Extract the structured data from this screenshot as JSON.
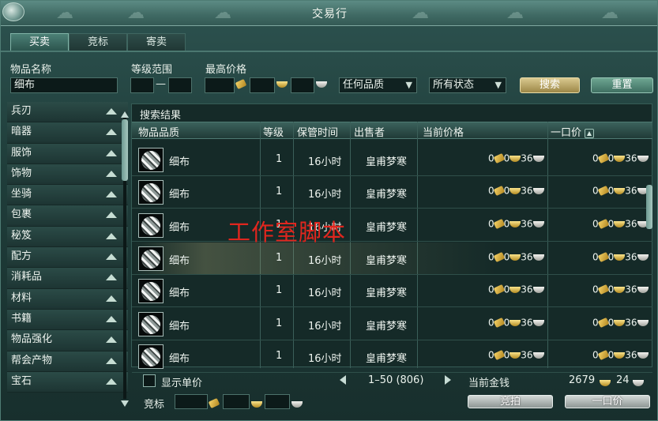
{
  "window": {
    "title": "交易行"
  },
  "tabs": [
    "买卖",
    "竞标",
    "寄卖"
  ],
  "search": {
    "name_label": "物品名称",
    "name_value": "细布",
    "level_label": "等级范围",
    "level_dash": "—",
    "price_label": "最高价格",
    "quality_select": "任何品质",
    "status_select": "所有状态",
    "search_button": "搜索",
    "reset_button": "重置"
  },
  "categories": [
    "兵刃",
    "暗器",
    "服饰",
    "饰物",
    "坐骑",
    "包裹",
    "秘笈",
    "配方",
    "消耗品",
    "材料",
    "书籍",
    "物品强化",
    "帮会产物",
    "宝石"
  ],
  "results": {
    "title": "搜索结果",
    "columns": {
      "quality": "物品品质",
      "level": "等级",
      "duration": "保管时间",
      "seller": "出售者",
      "current_price": "当前价格",
      "buyout": "一口价"
    },
    "rows": [
      {
        "name": "细布",
        "level": "1",
        "duration": "16小时",
        "seller": "皇甫梦寒",
        "cur_gold": "0",
        "cur_silver": "0",
        "cur_copper": "36",
        "buy_gold": "0",
        "buy_silver": "0",
        "buy_copper": "36"
      },
      {
        "name": "细布",
        "level": "1",
        "duration": "16小时",
        "seller": "皇甫梦寒",
        "cur_gold": "0",
        "cur_silver": "0",
        "cur_copper": "36",
        "buy_gold": "0",
        "buy_silver": "0",
        "buy_copper": "36"
      },
      {
        "name": "细布",
        "level": "1",
        "duration": "16小时",
        "seller": "皇甫梦寒",
        "cur_gold": "0",
        "cur_silver": "0",
        "cur_copper": "36",
        "buy_gold": "0",
        "buy_silver": "0",
        "buy_copper": "36"
      },
      {
        "name": "细布",
        "level": "1",
        "duration": "16小时",
        "seller": "皇甫梦寒",
        "cur_gold": "0",
        "cur_silver": "0",
        "cur_copper": "36",
        "buy_gold": "0",
        "buy_silver": "0",
        "buy_copper": "36"
      },
      {
        "name": "细布",
        "level": "1",
        "duration": "16小时",
        "seller": "皇甫梦寒",
        "cur_gold": "0",
        "cur_silver": "0",
        "cur_copper": "36",
        "buy_gold": "0",
        "buy_silver": "0",
        "buy_copper": "36"
      },
      {
        "name": "细布",
        "level": "1",
        "duration": "16小时",
        "seller": "皇甫梦寒",
        "cur_gold": "0",
        "cur_silver": "0",
        "cur_copper": "36",
        "buy_gold": "0",
        "buy_silver": "0",
        "buy_copper": "36"
      },
      {
        "name": "细布",
        "level": "1",
        "duration": "16小时",
        "seller": "皇甫梦寒",
        "cur_gold": "0",
        "cur_silver": "0",
        "cur_copper": "36",
        "buy_gold": "0",
        "buy_silver": "0",
        "buy_copper": "36"
      }
    ]
  },
  "watermark": "工作室脚本",
  "footer": {
    "show_unit_price": "显示单价",
    "pagination": "1–50 (806)",
    "current_money_label": "当前金钱",
    "money_gold": "2679",
    "money_silver": "24",
    "bid_label": "竞标",
    "bid_button": "竞拍",
    "buyout_button": "一口价"
  },
  "colors": {
    "accent_gold": "#d9c98f",
    "watermark_red": "#e0261e",
    "panel_teal": "#1f3d3a"
  }
}
